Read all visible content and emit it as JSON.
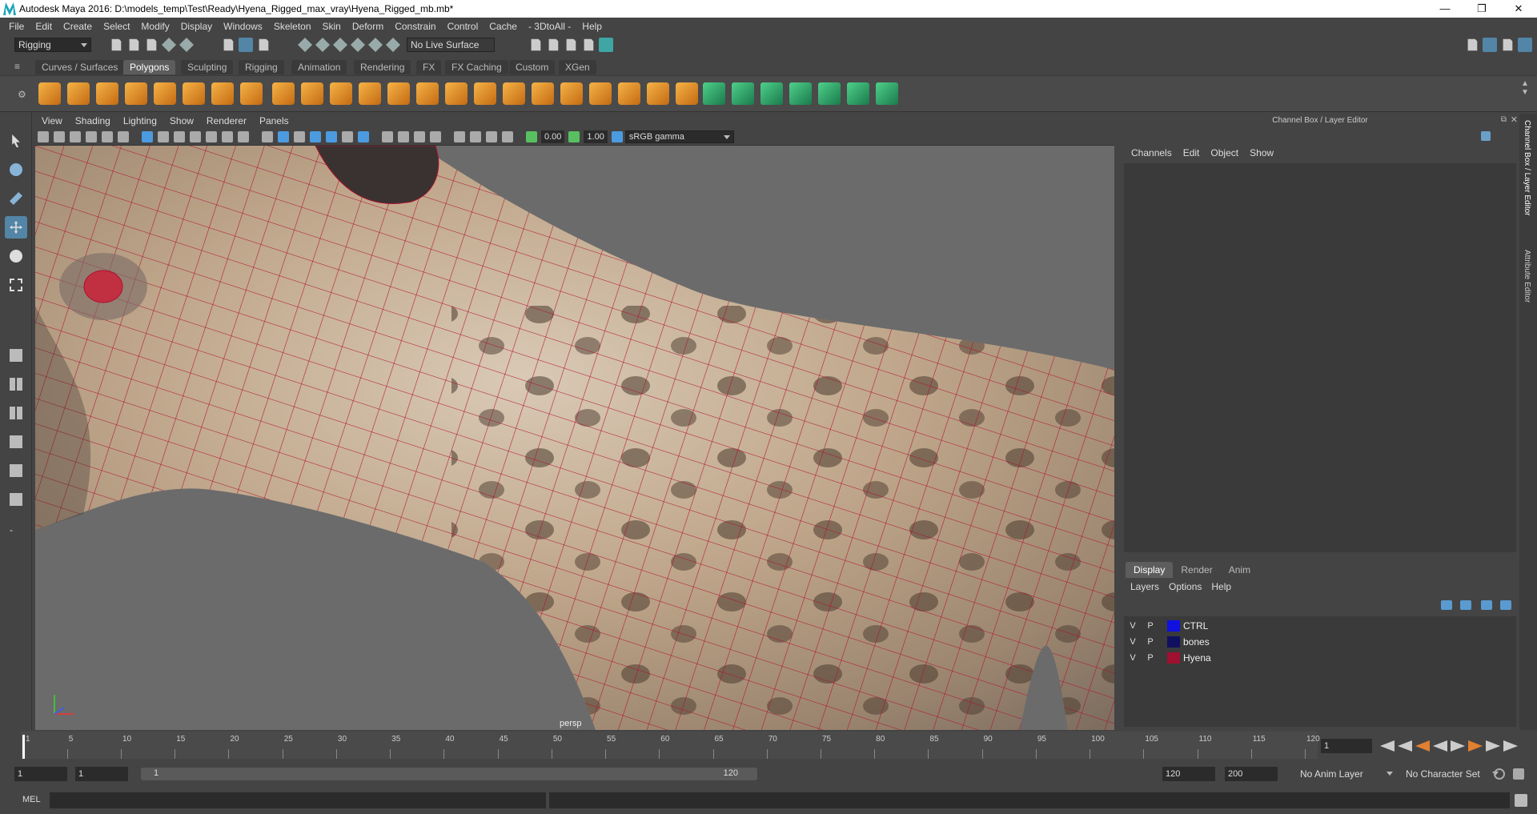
{
  "window": {
    "title": "Autodesk Maya 2016: D:\\models_temp\\Test\\Ready\\Hyena_Rigged_max_vray\\Hyena_Rigged_mb.mb*",
    "minimize": "—",
    "restore": "❐",
    "close": "✕"
  },
  "menubar": [
    "File",
    "Edit",
    "Create",
    "Select",
    "Modify",
    "Display",
    "Windows",
    "Skeleton",
    "Skin",
    "Deform",
    "Constrain",
    "Control",
    "Cache",
    "- 3DtoAll -",
    "Help"
  ],
  "statusline": {
    "mode": "Rigging",
    "live_surface": "No Live Surface"
  },
  "shelf": {
    "tabs": [
      "Curves / Surfaces",
      "Polygons",
      "Sculpting",
      "Rigging",
      "Animation",
      "Rendering",
      "FX",
      "FX Caching",
      "Custom",
      "XGen"
    ],
    "active_tab": "Polygons"
  },
  "viewport": {
    "menu": [
      "View",
      "Shading",
      "Lighting",
      "Show",
      "Renderer",
      "Panels"
    ],
    "exposure": "0.00",
    "gamma": "1.00",
    "color_space": "sRGB gamma",
    "camera_label": "persp"
  },
  "channel_box": {
    "header": "Channel Box / Layer Editor",
    "menu": [
      "Channels",
      "Edit",
      "Object",
      "Show"
    ]
  },
  "layer_editor": {
    "tabs": [
      "Display",
      "Render",
      "Anim"
    ],
    "active_tab": "Display",
    "menu": [
      "Layers",
      "Options",
      "Help"
    ],
    "layers": [
      {
        "v": "V",
        "p": "P",
        "color": "#1010e0",
        "name": "CTRL"
      },
      {
        "v": "V",
        "p": "P",
        "color": "#101060",
        "name": "bones"
      },
      {
        "v": "V",
        "p": "P",
        "color": "#a01030",
        "name": "Hyena"
      }
    ]
  },
  "side_tabs": [
    "Channel Box / Layer Editor",
    "Attribute Editor"
  ],
  "timeline": {
    "ticks": [
      1,
      5,
      10,
      15,
      20,
      25,
      30,
      35,
      40,
      45,
      50,
      55,
      60,
      65,
      70,
      75,
      80,
      85,
      90,
      95,
      100,
      105,
      110,
      115,
      120
    ],
    "current_frame": "1"
  },
  "range": {
    "start": "1",
    "anim_start": "1",
    "slider_start": "1",
    "slider_end": "120",
    "anim_end": "120",
    "end": "200",
    "anim_layer": "No Anim Layer",
    "character_set": "No Character Set"
  },
  "cmdline": {
    "label": "MEL"
  },
  "colors": {
    "selection_blue": "#5285a6",
    "wireframe": "#b01030"
  }
}
